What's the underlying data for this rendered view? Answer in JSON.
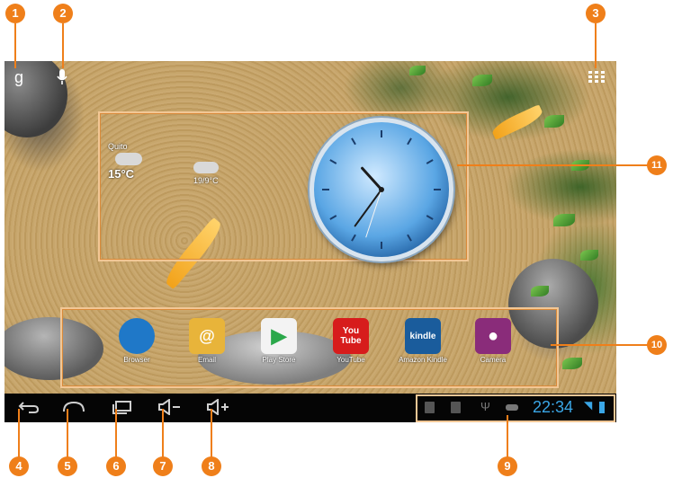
{
  "callouts": [
    "1",
    "2",
    "3",
    "4",
    "5",
    "6",
    "7",
    "8",
    "9",
    "10",
    "11"
  ],
  "top_bar": {
    "google_search": "g",
    "voice_search": "🎤",
    "app_drawer": "⋮⋮⋮"
  },
  "weather": {
    "city": "Quito",
    "temperature": "15°C",
    "secondary": "19/9°C"
  },
  "clock": {
    "hour": 10,
    "minute": 36,
    "second": 33
  },
  "dock_apps": [
    {
      "label": "Browser",
      "icon": "globe-icon",
      "color": "#1f78c8"
    },
    {
      "label": "Email",
      "icon": "envelope-icon",
      "color": "#e8b43a"
    },
    {
      "label": "Play Store",
      "icon": "play-store-icon",
      "color": "#f3f3f3"
    },
    {
      "label": "YouTube",
      "icon": "youtube-icon",
      "color": "#d71c1c",
      "text": "You\nTube"
    },
    {
      "label": "Amazon Kindle",
      "icon": "kindle-icon",
      "color": "#1a5c9c",
      "text": "kindle"
    },
    {
      "label": "Camera",
      "icon": "camera-icon",
      "color": "#8a2c7a"
    }
  ],
  "nav_buttons": {
    "back": "⮌",
    "home": "⌂",
    "recent": "▭",
    "volume_down": "◁−",
    "volume_up": "◁+"
  },
  "status_bar": {
    "time": "22:34",
    "accent": "#3aa6e6"
  },
  "colors": {
    "callout": "#ef7f1a",
    "frame": "#f2c795"
  }
}
